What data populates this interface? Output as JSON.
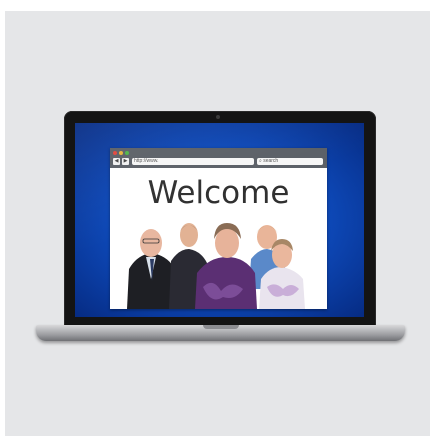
{
  "browser": {
    "url": "http://www.",
    "search_placeholder": "search",
    "back_icon": "◀",
    "forward_icon": "▶"
  },
  "page": {
    "heading": "Welcome"
  },
  "colors": {
    "screen_blue": "#0d47b5",
    "backdrop": "#e5e6e8"
  }
}
